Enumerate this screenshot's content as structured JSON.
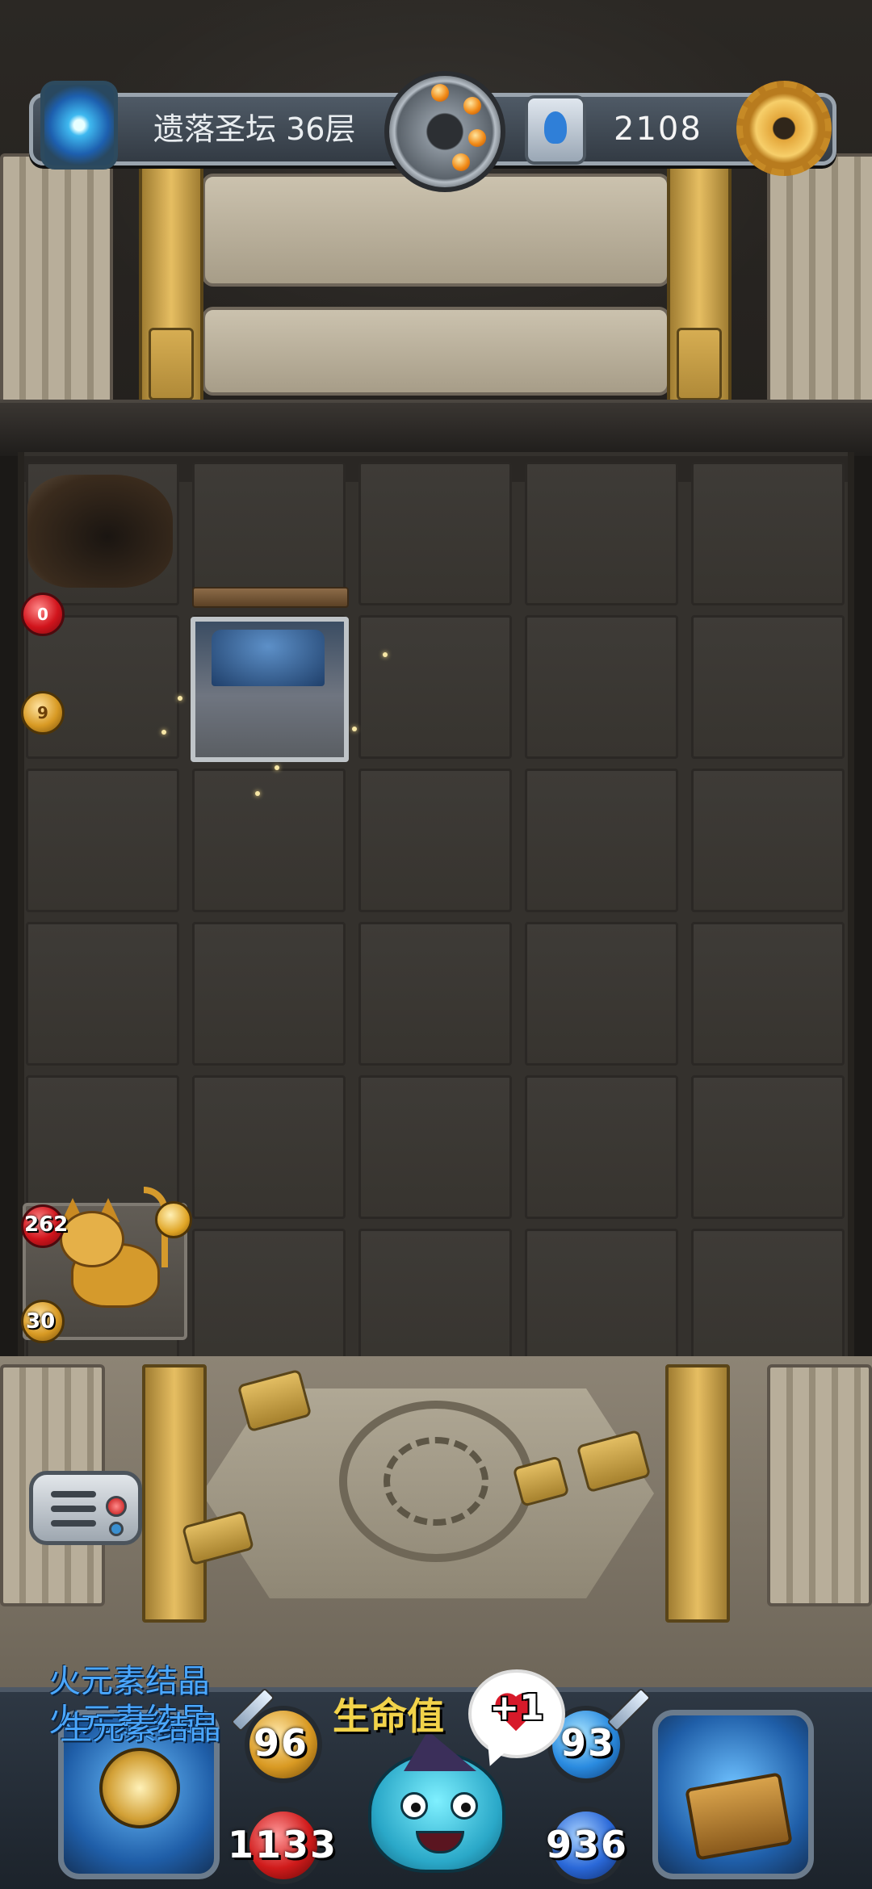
{
  "header": {
    "floor_title": "遗落圣坛 36层",
    "currency_value": "2108",
    "icons": [
      "portal-icon",
      "bomb-medallion-icon",
      "crystal-currency-icon",
      "gear-icon"
    ]
  },
  "board": {
    "rows": 6,
    "cols": 5,
    "row_badges": [
      {
        "type": "hp",
        "value": "0"
      },
      {
        "type": "atk",
        "value": "9"
      }
    ],
    "monster": {
      "name": "cat-monster",
      "hp": "262",
      "atk": "30"
    }
  },
  "hud": {
    "floating_label_1": "火元素结晶",
    "floating_label_2": "火元素结晶",
    "floating_label_3": "生元素结晶",
    "hp_gain_label": "生命值",
    "hp_gain_value": "+1",
    "attack": "96",
    "defense": "93",
    "hp": "1133",
    "mp": "936"
  },
  "colors": {
    "accent_gold": "#e6be62",
    "hp_red": "#d01b1b",
    "mana_blue": "#2a68d8",
    "label_blue": "#4aa7ff"
  }
}
